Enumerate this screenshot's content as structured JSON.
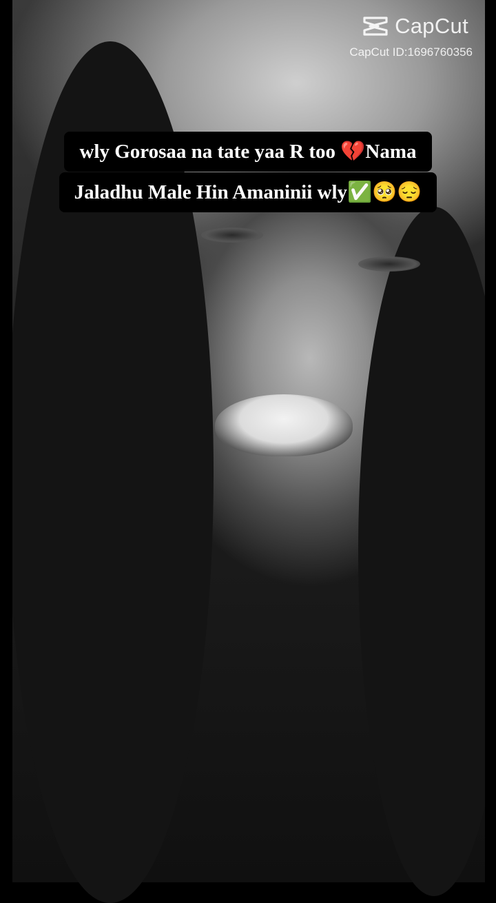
{
  "watermark": {
    "brand_name": "CapCut",
    "id_text": "CapCut ID:1696760356",
    "logo_icon": "capcut-logo-icon"
  },
  "caption": {
    "line1": "wly Gorosaa na tate yaa R too 💔Nama",
    "line2": "Jaladhu Male Hin Amaninii wly✅🥺😔"
  },
  "colors": {
    "caption_bg": "#000000",
    "caption_text": "#ffffff",
    "watermark_text": "#ffffff"
  }
}
